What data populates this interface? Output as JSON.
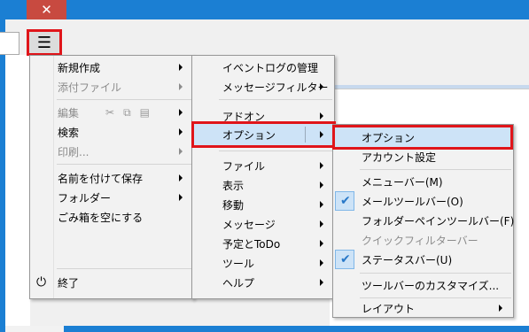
{
  "window": {
    "close_glyph": "✕",
    "menu_glyph": "☰"
  },
  "menu1": {
    "items": [
      {
        "label": "新規作成"
      },
      {
        "label": "添付ファイル"
      },
      {
        "label": "編集"
      },
      {
        "label": "検索"
      },
      {
        "label": "印刷..."
      },
      {
        "label": "名前を付けて保存"
      },
      {
        "label": "フォルダー"
      },
      {
        "label": "ごみ箱を空にする"
      },
      {
        "label": "終了"
      }
    ]
  },
  "menu2": {
    "items": [
      {
        "label": "イベントログの管理"
      },
      {
        "label": "メッセージフィルター"
      },
      {
        "label": "アドオン"
      },
      {
        "label": "オプション"
      },
      {
        "label": "ファイル"
      },
      {
        "label": "表示"
      },
      {
        "label": "移動"
      },
      {
        "label": "メッセージ"
      },
      {
        "label": "予定とToDo"
      },
      {
        "label": "ツール"
      },
      {
        "label": "ヘルプ"
      }
    ]
  },
  "menu3": {
    "items": [
      {
        "label": "オプション"
      },
      {
        "label": "アカウント設定"
      },
      {
        "label": "メニューバー(M)"
      },
      {
        "label": "メールツールバー(O)"
      },
      {
        "label": "フォルダーペインツールバー(F)"
      },
      {
        "label": "クイックフィルターバー"
      },
      {
        "label": "ステータスバー(U)"
      },
      {
        "label": "ツールバーのカスタマイズ..."
      },
      {
        "label": "レイアウト"
      }
    ]
  },
  "colors": {
    "highlight_border": "#e0151a",
    "highlight_fill": "#cde3f7",
    "titlebar": "#1b7fd3"
  }
}
